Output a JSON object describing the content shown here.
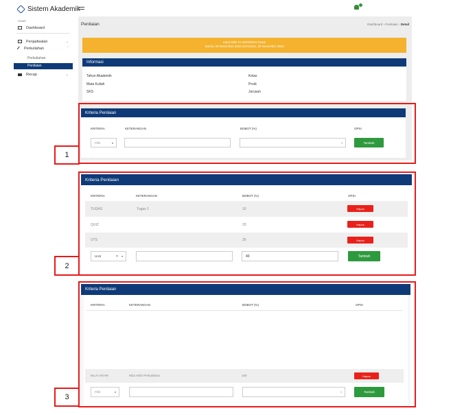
{
  "app": {
    "brand": "Sistem Akademik"
  },
  "sidebar": {
    "section_home": "HOME",
    "items": [
      {
        "label": "Dashboard"
      },
      {
        "label": "Penjadwalan"
      },
      {
        "label": "Perkuliahan"
      }
    ],
    "sub_items": [
      "Perkuliahan",
      "Penilaian"
    ],
    "active": "Penilaian",
    "recap": "Recap"
  },
  "page": {
    "title": "Penilaian",
    "breadcrumb": [
      "Dashboard",
      "Penilaian",
      "Detail"
    ]
  },
  "banner": {
    "line1": "Input Nilai TA 2023/2024 Gasal",
    "line2": "Kamis, 09 November 2023 s/d Kamis, 30 November 2023"
  },
  "info": {
    "header": "Informasi",
    "left": [
      "Tahun Akademik",
      "Mata Kuliah",
      "SKS"
    ],
    "right": [
      "Kelas",
      "Prodi",
      "Jurusan"
    ]
  },
  "criteria": {
    "header": "Kriteria Penilaian",
    "columns": [
      "KRITERIA",
      "KETERANGAN",
      "BOBOT (%)",
      "OPSI"
    ],
    "select_placeholder": "Pilih",
    "add_label": "Tambah",
    "delete_label": "Hapus"
  },
  "panel2": {
    "rows": [
      {
        "kriteria": "TUGAS",
        "keterangan": "Tugas 1",
        "bobot": "10"
      },
      {
        "kriteria": "QUIZ",
        "keterangan": "",
        "bobot": "20"
      },
      {
        "kriteria": "UTS",
        "keterangan": "",
        "bobot": "30"
      }
    ],
    "form": {
      "kriteria": "UAS",
      "clear": "×",
      "bobot": "40"
    }
  },
  "panel3": {
    "rows": [
      {
        "kriteria": "NILAI AKHIR",
        "keterangan": "Nilai Akhir Perkuliahan",
        "bobot": "100"
      }
    ]
  },
  "annotations": {
    "labels": [
      "1",
      "2",
      "3"
    ]
  },
  "colors": {
    "navy": "#0e3a78",
    "banner": "#f4b22e",
    "add": "#2d9a3d",
    "delete": "#e8221b",
    "highlight": "#e61919"
  }
}
